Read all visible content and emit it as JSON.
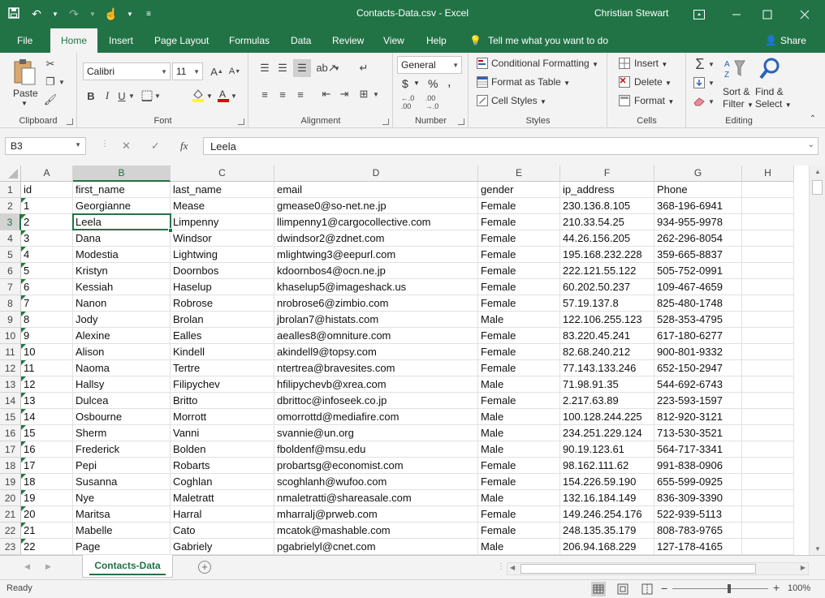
{
  "titlebar": {
    "document_title": "Contacts-Data.csv  -  Excel",
    "user_name": "Christian Stewart"
  },
  "ribbon_tabs": [
    "File",
    "Home",
    "Insert",
    "Page Layout",
    "Formulas",
    "Data",
    "Review",
    "View",
    "Help"
  ],
  "tell_me": "Tell me what you want to do",
  "share_label": "Share",
  "ribbon": {
    "clipboard": {
      "label": "Clipboard",
      "paste": "Paste"
    },
    "font": {
      "label": "Font",
      "name": "Calibri",
      "size": "11"
    },
    "alignment": {
      "label": "Alignment"
    },
    "number": {
      "label": "Number",
      "format": "General",
      "currency": "$",
      "percent": "%",
      "comma": ","
    },
    "styles": {
      "label": "Styles",
      "conditional": "Conditional Formatting",
      "format_table": "Format as Table",
      "cell_styles": "Cell Styles"
    },
    "cells": {
      "label": "Cells",
      "insert": "Insert",
      "delete": "Delete",
      "format": "Format"
    },
    "editing": {
      "label": "Editing",
      "sort1": "Sort &",
      "sort2": "Filter",
      "find1": "Find &",
      "find2": "Select"
    }
  },
  "formula_bar": {
    "name_box": "B3",
    "formula": "Leela"
  },
  "columns": [
    "A",
    "B",
    "C",
    "D",
    "E",
    "F",
    "G",
    "H"
  ],
  "rows": [
    [
      "id",
      "first_name",
      "last_name",
      "email",
      "gender",
      "ip_address",
      "Phone",
      ""
    ],
    [
      "1",
      "Georgianne",
      "Mease",
      "gmease0@so-net.ne.jp",
      "Female",
      "230.136.8.105",
      "368-196-6941",
      ""
    ],
    [
      "2",
      "Leela",
      "Limpenny",
      "llimpenny1@cargocollective.com",
      "Female",
      "210.33.54.25",
      "934-955-9978",
      ""
    ],
    [
      "3",
      "Dana",
      "Windsor",
      "dwindsor2@zdnet.com",
      "Female",
      "44.26.156.205",
      "262-296-8054",
      ""
    ],
    [
      "4",
      "Modestia",
      "Lightwing",
      "mlightwing3@eepurl.com",
      "Female",
      "195.168.232.228",
      "359-665-8837",
      ""
    ],
    [
      "5",
      "Kristyn",
      "Doornbos",
      "kdoornbos4@ocn.ne.jp",
      "Female",
      "222.121.55.122",
      "505-752-0991",
      ""
    ],
    [
      "6",
      "Kessiah",
      "Haselup",
      "khaselup5@imageshack.us",
      "Female",
      "60.202.50.237",
      "109-467-4659",
      ""
    ],
    [
      "7",
      "Nanon",
      "Robrose",
      "nrobrose6@zimbio.com",
      "Female",
      "57.19.137.8",
      "825-480-1748",
      ""
    ],
    [
      "8",
      "Jody",
      "Brolan",
      "jbrolan7@histats.com",
      "Male",
      "122.106.255.123",
      "528-353-4795",
      ""
    ],
    [
      "9",
      "Alexine",
      "Ealles",
      "aealles8@omniture.com",
      "Female",
      "83.220.45.241",
      "617-180-6277",
      ""
    ],
    [
      "10",
      "Alison",
      "Kindell",
      "akindell9@topsy.com",
      "Female",
      "82.68.240.212",
      "900-801-9332",
      ""
    ],
    [
      "11",
      "Naoma",
      "Tertre",
      "ntertrea@bravesites.com",
      "Female",
      "77.143.133.246",
      "652-150-2947",
      ""
    ],
    [
      "12",
      "Hallsy",
      "Filipychev",
      "hfilipychevb@xrea.com",
      "Male",
      "71.98.91.35",
      "544-692-6743",
      ""
    ],
    [
      "13",
      "Dulcea",
      "Britto",
      "dbrittoc@infoseek.co.jp",
      "Female",
      "2.217.63.89",
      "223-593-1597",
      ""
    ],
    [
      "14",
      "Osbourne",
      "Morrott",
      "omorrottd@mediafire.com",
      "Male",
      "100.128.244.225",
      "812-920-3121",
      ""
    ],
    [
      "15",
      "Sherm",
      "Vanni",
      "svannie@un.org",
      "Male",
      "234.251.229.124",
      "713-530-3521",
      ""
    ],
    [
      "16",
      "Frederick",
      "Bolden",
      "fboldenf@msu.edu",
      "Male",
      "90.19.123.61",
      "564-717-3341",
      ""
    ],
    [
      "17",
      "Pepi",
      "Robarts",
      "probartsg@economist.com",
      "Female",
      "98.162.111.62",
      "991-838-0906",
      ""
    ],
    [
      "18",
      "Susanna",
      "Coghlan",
      "scoghlanh@wufoo.com",
      "Female",
      "154.226.59.190",
      "655-599-0925",
      ""
    ],
    [
      "19",
      "Nye",
      "Maletratt",
      "nmaletratti@shareasale.com",
      "Male",
      "132.16.184.149",
      "836-309-3390",
      ""
    ],
    [
      "20",
      "Maritsa",
      "Harral",
      "mharralj@prweb.com",
      "Female",
      "149.246.254.176",
      "522-939-5113",
      ""
    ],
    [
      "21",
      "Mabelle",
      "Cato",
      "mcatok@mashable.com",
      "Female",
      "248.135.35.179",
      "808-783-9765",
      ""
    ],
    [
      "22",
      "Page",
      "Gabriely",
      "pgabrielyl@cnet.com",
      "Male",
      "206.94.168.229",
      "127-178-4165",
      ""
    ]
  ],
  "sheet_tab": "Contacts-Data",
  "status": {
    "ready": "Ready",
    "zoom": "100%"
  },
  "colors": {
    "accent": "#217346",
    "number_as_text_marker": "#1e7a3c"
  }
}
